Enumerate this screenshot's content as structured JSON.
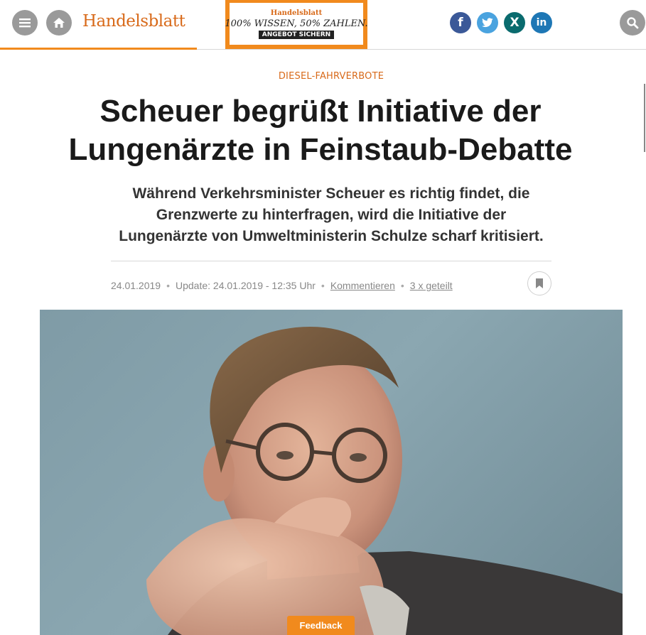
{
  "header": {
    "logo": "Handelsblatt",
    "ad": {
      "brand": "Handelsblatt",
      "claim": "100% WISSEN, 50% ZAHLEN.",
      "cta": "ANGEBOT SICHERN"
    },
    "social": {
      "facebook": "f",
      "twitter": "twitter-icon",
      "xing": "X",
      "linkedin": "in"
    },
    "icons": {
      "menu": "menu-icon",
      "home": "home-icon",
      "search": "search-icon"
    },
    "accent_color": "#f18a1d"
  },
  "article": {
    "kicker": "DIESEL-FAHRVERBOTE",
    "headline": "Scheuer begrüßt Initiative der Lungenärzte in Feinstaub-Debatte",
    "lead": "Während Verkehrsminister Scheuer es richtig findet, die Grenzwerte zu hinterfragen, wird die Initiative der Lungenärzte von Umweltministerin Schulze scharf kritisiert.",
    "meta": {
      "date": "24.01.2019",
      "update": "Update: 24.01.2019 - 12:35 Uhr",
      "comment_link": "Kommentieren",
      "shared": "3 x geteilt",
      "separator": "•"
    }
  },
  "feedback": {
    "label": "Feedback"
  }
}
